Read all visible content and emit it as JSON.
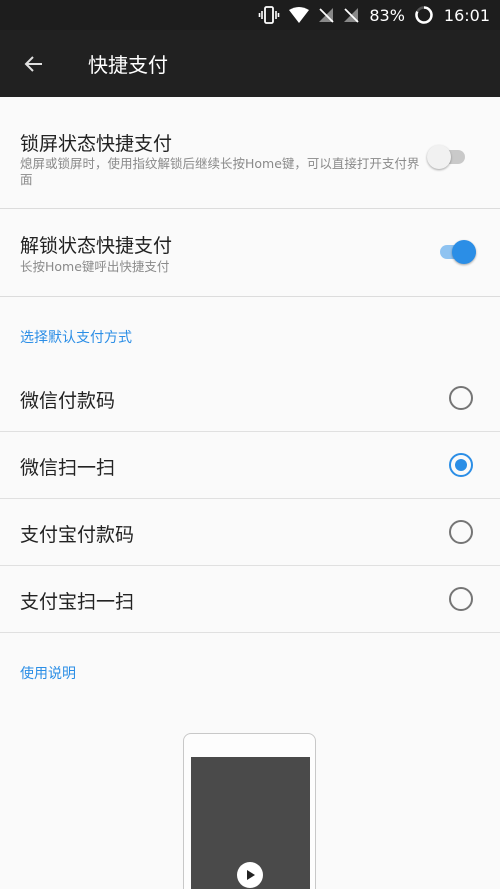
{
  "status_bar": {
    "battery_percent": "83%",
    "time": "16:01",
    "icons": [
      "vibrate-icon",
      "wifi-icon",
      "no-sim-icon",
      "no-sim-icon",
      "battery-icon"
    ]
  },
  "app_bar": {
    "back_icon": "arrow-left-icon",
    "title": "快捷支付"
  },
  "preferences": {
    "lock_screen": {
      "title": "锁屏状态快捷支付",
      "summary": "熄屏或锁屏时，使用指纹解锁后继续长按Home键，可以直接打开支付界面",
      "enabled": false
    },
    "unlocked": {
      "title": "解锁状态快捷支付",
      "summary": "长按Home键呼出快捷支付",
      "enabled": true
    }
  },
  "payment_section": {
    "header": "选择默认支付方式",
    "options": [
      {
        "label": "微信付款码",
        "selected": false
      },
      {
        "label": "微信扫一扫",
        "selected": true
      },
      {
        "label": "支付宝付款码",
        "selected": false
      },
      {
        "label": "支付宝扫一扫",
        "selected": false
      }
    ]
  },
  "instructions_section": {
    "header": "使用说明"
  },
  "colors": {
    "accent": "#2b8ee6",
    "app_bar": "#212121",
    "status_bar": "#1d1d1d",
    "background": "#fafafa"
  }
}
